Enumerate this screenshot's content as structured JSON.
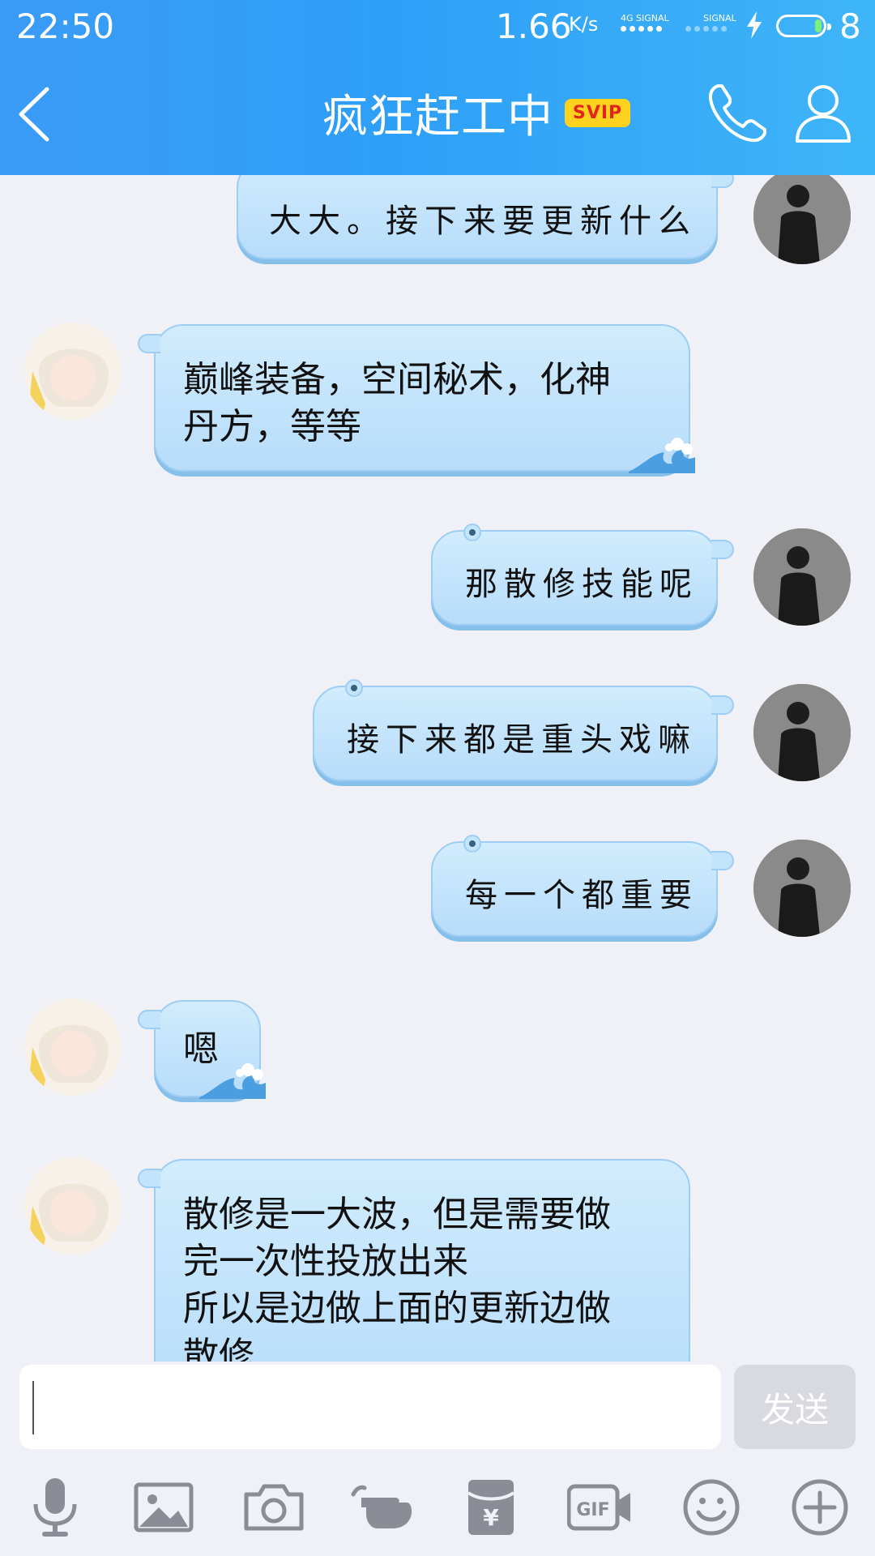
{
  "status_bar": {
    "time": "22:50",
    "speed": "1.66",
    "speed_unit": "K/s",
    "sim1_label": "4G SIGNAL",
    "sim2_label": "SIGNAL",
    "battery": "8"
  },
  "header": {
    "title": "疯狂赶工中",
    "badge": "SVIP",
    "back_icon": "chevron-left-icon",
    "call_icon": "phone-icon",
    "profile_icon": "person-icon"
  },
  "messages": [
    {
      "sender": "self",
      "text": "大大。接下来要更新什么"
    },
    {
      "sender": "other",
      "text": "巅峰装备，空间秘术，化神\n丹方，等等"
    },
    {
      "sender": "self",
      "text": "那散修技能呢"
    },
    {
      "sender": "self",
      "text": "接下来都是重头戏嘛"
    },
    {
      "sender": "self",
      "text": "每一个都重要"
    },
    {
      "sender": "other",
      "text": "嗯"
    },
    {
      "sender": "other",
      "text": "散修是一大波，但是需要做\n完一次性投放出来\n所以是边做上面的更新边做\n散修"
    }
  ],
  "composer": {
    "input_value": "",
    "send_label": "发送"
  },
  "toolbar": [
    "microphone-icon",
    "image-icon",
    "camera-icon",
    "poke-icon",
    "red-packet-icon",
    "gif-icon",
    "emoji-icon",
    "plus-icon"
  ],
  "colors": {
    "header_start": "#3a9bf6",
    "header_end": "#3fb5f9",
    "bubble": "#c4e4fb",
    "background": "#eff1f7",
    "badge": "#ffd21f"
  }
}
